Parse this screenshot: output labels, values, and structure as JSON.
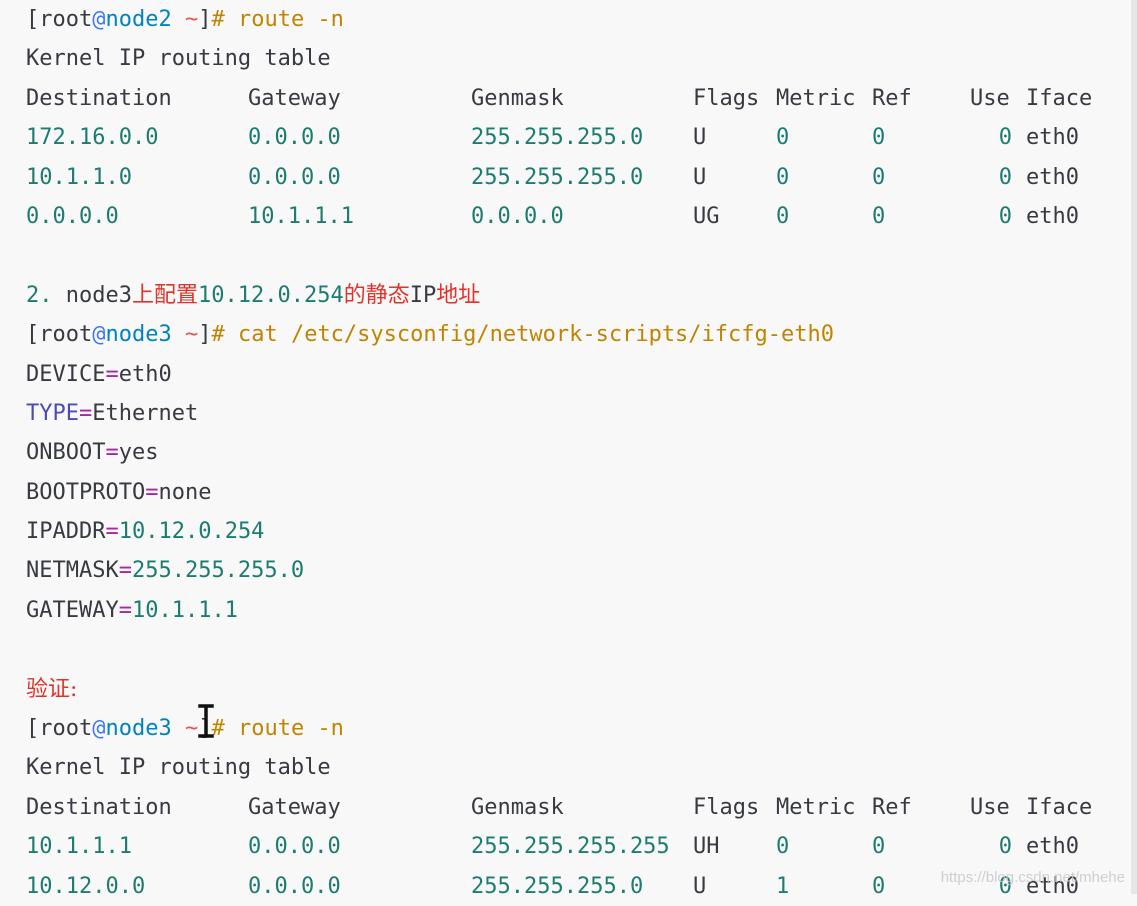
{
  "block1": {
    "prompt_user": "root",
    "prompt_host": "node2",
    "prompt_dir": "~",
    "command": "route -n",
    "table_title": "Kernel IP routing table",
    "headers": [
      "Destination",
      "Gateway",
      "Genmask",
      "Flags",
      "Metric",
      "Ref",
      "Use",
      "Iface"
    ],
    "rows": [
      [
        "172.16.0.0",
        "0.0.0.0",
        "255.255.255.0",
        "U",
        "0",
        "0",
        "0",
        "eth0"
      ],
      [
        "10.1.1.0",
        "0.0.0.0",
        "255.255.255.0",
        "U",
        "0",
        "0",
        "0",
        "eth0"
      ],
      [
        "0.0.0.0",
        "10.1.1.1",
        "0.0.0.0",
        "UG",
        "0",
        "0",
        "0",
        "eth0"
      ]
    ]
  },
  "step2": {
    "number": "2.",
    "host": "node3",
    "text_before": "上配置",
    "ip": "10.12.0.254",
    "text_middle": "的静态",
    "ip_word": "IP",
    "text_after": "地址"
  },
  "block2": {
    "prompt_user": "root",
    "prompt_host": "node3",
    "prompt_dir": "~",
    "command": "cat /etc/sysconfig/network-scripts/ifcfg-eth0",
    "config": [
      {
        "key": "DEVICE",
        "value": "eth0"
      },
      {
        "key": "TYPE",
        "value": "Ethernet"
      },
      {
        "key": "ONBOOT",
        "value": "yes"
      },
      {
        "key": "BOOTPROTO",
        "value": "none"
      },
      {
        "key": "IPADDR",
        "value": "10.12.0.254"
      },
      {
        "key": "NETMASK",
        "value": "255.255.255.0"
      },
      {
        "key": "GATEWAY",
        "value": "10.1.1.1"
      }
    ]
  },
  "verify_label": "验证:",
  "block3": {
    "prompt_user": "root",
    "prompt_host": "node3",
    "prompt_dir": "~",
    "command": "route -n",
    "table_title": "Kernel IP routing table",
    "headers": [
      "Destination",
      "Gateway",
      "Genmask",
      "Flags",
      "Metric",
      "Ref",
      "Use",
      "Iface"
    ],
    "rows": [
      [
        "10.1.1.1",
        "0.0.0.0",
        "255.255.255.255",
        "UH",
        "0",
        "0",
        "0",
        "eth0"
      ],
      [
        "10.12.0.0",
        "0.0.0.0",
        "255.255.255.0",
        "U",
        "1",
        "0",
        "0",
        "eth0"
      ]
    ]
  },
  "watermark": "https://blog.csdn.net/mhehe"
}
